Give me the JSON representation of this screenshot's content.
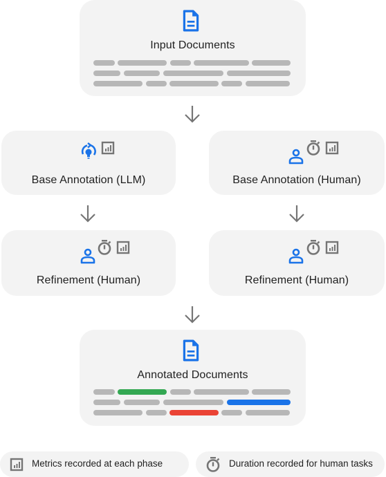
{
  "colors": {
    "box_bg": "#f3f3f3",
    "accent_blue": "#1a73e8",
    "icon_gray": "#757575",
    "line_gray": "#b7b7b7",
    "highlight_green": "#34a853",
    "highlight_blue": "#1a73e8",
    "highlight_red": "#ea4335"
  },
  "nodes": {
    "input": {
      "title": "Input Documents",
      "icon": "document-icon"
    },
    "base_llm": {
      "title": "Base Annotation (LLM)",
      "icons": [
        "llm-refresh-bulb-icon",
        "metrics-chart-icon"
      ]
    },
    "base_human": {
      "title": "Base Annotation (Human)",
      "icons": [
        "person-icon",
        "stopwatch-icon",
        "metrics-chart-icon"
      ]
    },
    "refine_left": {
      "title": "Refinement (Human)",
      "icons": [
        "person-icon",
        "stopwatch-icon",
        "metrics-chart-icon"
      ]
    },
    "refine_right": {
      "title": "Refinement (Human)",
      "icons": [
        "person-icon",
        "stopwatch-icon",
        "metrics-chart-icon"
      ]
    },
    "output": {
      "title": "Annotated Documents",
      "icon": "document-icon",
      "highlights": [
        "green",
        "blue",
        "red"
      ]
    }
  },
  "legend": [
    {
      "icon": "metrics-chart-icon",
      "label": "Metrics recorded at each phase"
    },
    {
      "icon": "stopwatch-icon",
      "label": "Duration recorded for human tasks"
    }
  ]
}
